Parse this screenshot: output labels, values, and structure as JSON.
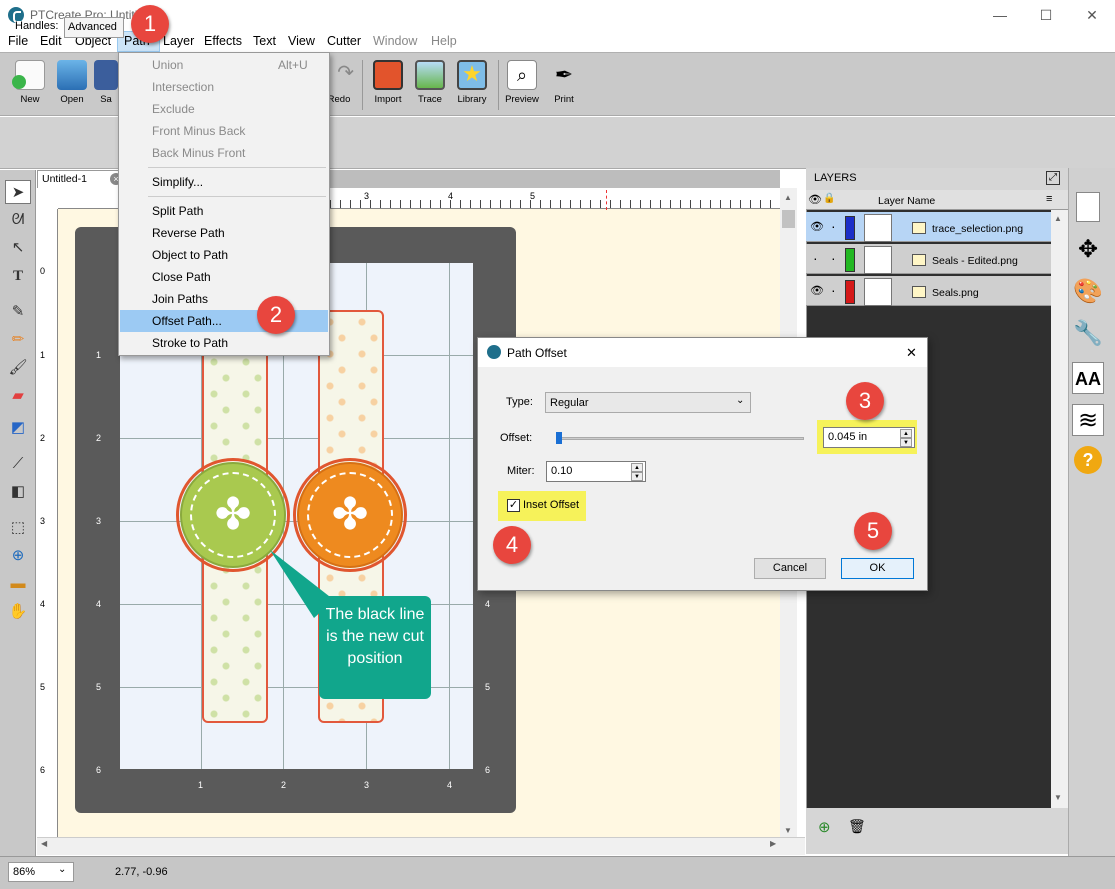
{
  "window": {
    "title": "PTCreate Pro: Untitl",
    "minimize": "—",
    "maximize": "☐",
    "close": "✕"
  },
  "menu": [
    "File",
    "Edit",
    "Object",
    "Path",
    "Layer",
    "Effects",
    "Text",
    "View",
    "Cutter",
    "Window",
    "Help"
  ],
  "toolbar": {
    "new": "New",
    "open": "Open",
    "save": "Sa",
    "redo": "Redo",
    "import": "Import",
    "trace": "Trace",
    "library": "Library",
    "preview": "Preview",
    "print": "Print"
  },
  "options": {
    "handles_label": "Handles:",
    "handles_value": "Advanced"
  },
  "doc": {
    "tab": "Untitled-1",
    "close": "×"
  },
  "path_menu": {
    "union": "Union",
    "union_shortcut": "Alt+U",
    "intersection": "Intersection",
    "exclude": "Exclude",
    "front_minus_back": "Front Minus Back",
    "back_minus_front": "Back Minus Front",
    "simplify": "Simplify...",
    "split_path": "Split Path",
    "reverse_path": "Reverse Path",
    "object_to_path": "Object to Path",
    "close_path": "Close Path",
    "join_paths": "Join Paths",
    "offset_path": "Offset Path...",
    "stroke_to_path": "Stroke to Path"
  },
  "ruler": {
    "h": [
      "3",
      "4",
      "5"
    ],
    "h_bottom": [
      "1",
      "2",
      "3",
      "4"
    ],
    "v": [
      "0",
      "1",
      "2",
      "3",
      "4",
      "5",
      "6"
    ]
  },
  "layers": {
    "title": "LAYERS",
    "col": "Layer Name",
    "rows": [
      {
        "name": "trace_selection.png",
        "color": "#1c2fc8"
      },
      {
        "name": "Seals - Edited.png",
        "color": "#22b722"
      },
      {
        "name": "Seals.png",
        "color": "#d41818"
      }
    ]
  },
  "dialog": {
    "title": "Path Offset",
    "close": "✕",
    "type_label": "Type:",
    "type_value": "Regular",
    "offset_label": "Offset:",
    "offset_value": "0.045 in",
    "miter_label": "Miter:",
    "miter_value": "0.10",
    "inset_label": "Inset Offset",
    "inset_checked": "✓",
    "cancel": "Cancel",
    "ok": "OK"
  },
  "badges": [
    "1",
    "2",
    "3",
    "4",
    "5"
  ],
  "callout": "The black line is the new cut position",
  "status": {
    "zoom": "86%",
    "coords": "2.77, -0.96"
  },
  "icons": {
    "chevron": "⌄",
    "scroll_up": "▲",
    "scroll_down": "▼",
    "scroll_left": "◀",
    "scroll_right": "▶",
    "spin_up": "▲",
    "spin_down": "▼",
    "eye": "👁",
    "dot": "·",
    "lock": "🔒",
    "menu_lines": "≡",
    "resize": "⤢",
    "collapse": "⇱",
    "new_layer": "⊕",
    "trash": "🗑",
    "move": "✥",
    "palette": "🎨",
    "wrench": "🔧",
    "text": "AA",
    "layers": "≋",
    "help": "?"
  }
}
